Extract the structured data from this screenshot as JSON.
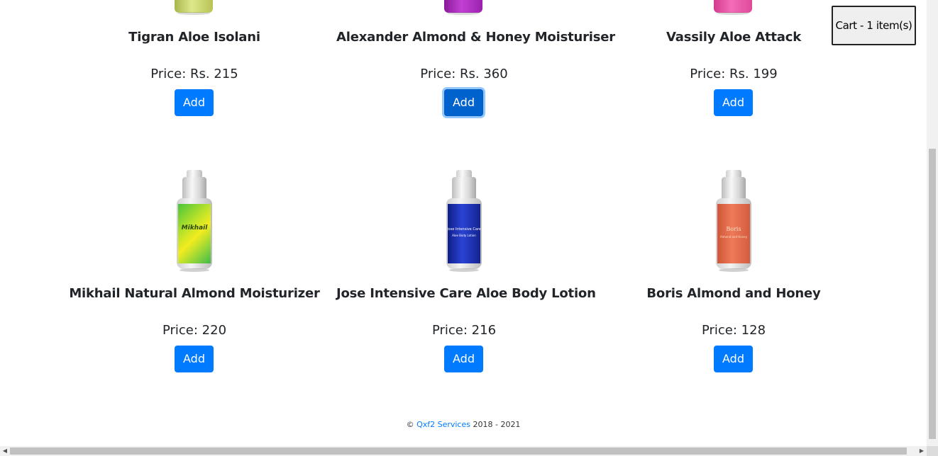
{
  "cart": {
    "label": "Cart - 1 item(s)"
  },
  "products_row1": [
    {
      "name": "Tigran Aloe Isolani",
      "price": "Price: Rs. 215",
      "button": "Add",
      "color": "#c7d36a"
    },
    {
      "name": "Alexander Almond & Honey Moisturiser",
      "price": "Price: Rs. 360",
      "button": "Add",
      "color": "#a020b0"
    },
    {
      "name": "Vassily Aloe Attack",
      "price": "Price: Rs. 199",
      "button": "Add",
      "color": "#e84aa0"
    }
  ],
  "products_row2": [
    {
      "name": "Mikhail Natural Almond Moisturizer",
      "price": "Price: 220",
      "button": "Add",
      "label_text": "Mikhail",
      "color": "#9fd82a"
    },
    {
      "name": "Jose Intensive Care Aloe Body Lotion",
      "price": "Price: 216",
      "button": "Add",
      "label_text": "Jose Intensive Care",
      "label_sub": "Aloe Body Lotion",
      "color": "#1c2fb0"
    },
    {
      "name": "Boris Almond and Honey",
      "price": "Price: 128",
      "button": "Add",
      "label_text": "Boris",
      "label_sub": "Almond and Honey",
      "color": "#e3674a"
    }
  ],
  "footer": {
    "copyright": "©",
    "company": "Qxf2 Services",
    "years": "2018 - 2021"
  },
  "scrollbar": {
    "left_arrow": "◀",
    "right_arrow": "▶"
  }
}
